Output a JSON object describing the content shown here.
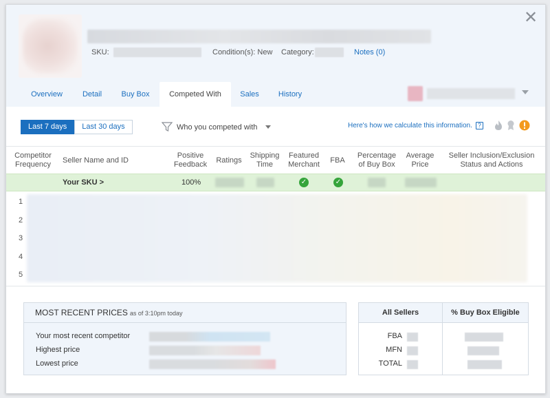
{
  "header": {
    "close_glyph": "✕",
    "sku_label": "SKU:",
    "condition_label": "Condition(s): New",
    "category_label": "Category:",
    "notes_link": "Notes (0)"
  },
  "tabs": [
    {
      "label": "Overview"
    },
    {
      "label": "Detail"
    },
    {
      "label": "Buy Box"
    },
    {
      "label": "Competed With"
    },
    {
      "label": "Sales"
    },
    {
      "label": "History"
    }
  ],
  "active_tab": "Competed With",
  "controls": {
    "range_options": [
      "Last 7 days",
      "Last 30 days"
    ],
    "selected_range": "Last 7 days",
    "filter_label": "Who you competed with",
    "calc_link": "Here's how we calculate this information.",
    "help_glyph": "?"
  },
  "table": {
    "headers": [
      "Competitor Frequency",
      "Seller Name and ID",
      "Positive Feedback",
      "Ratings",
      "Shipping Time",
      "Featured Merchant",
      "FBA",
      "Percentage of Buy Box",
      "Average Price",
      "Seller Inclusion/Exclusion Status and Actions"
    ],
    "your_row": {
      "name": "Your SKU >",
      "positive_feedback": "100%",
      "featured_merchant": true,
      "fba": true,
      "check_glyph": "✓"
    },
    "ranks": [
      "1",
      "2",
      "3",
      "4",
      "5"
    ]
  },
  "recent_prices": {
    "title": "MOST RECENT PRICES",
    "as_of": "as of 3:10pm today",
    "rows": [
      "Your most recent competitor",
      "Highest price",
      "Lowest price"
    ]
  },
  "sellers_table": {
    "col1": "All Sellers",
    "col2": "% Buy Box Eligible",
    "rows": [
      "FBA",
      "MFN",
      "TOTAL"
    ]
  },
  "colors": {
    "accent": "#1b6fbf",
    "header_bg": "#f0f5fb",
    "your_row_bg": "#dff2d8",
    "check_green": "#35a43b",
    "warning_orange": "#f39a1e"
  }
}
